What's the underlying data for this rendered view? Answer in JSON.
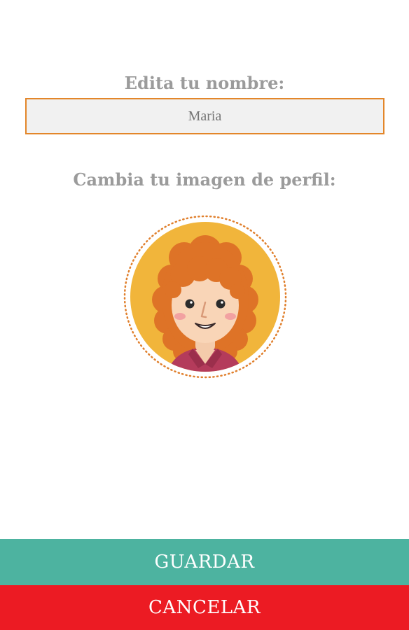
{
  "profile": {
    "name_label": "Edita tu nombre:",
    "name_placeholder": "Maria",
    "avatar_label": "Cambia tu imagen de perfil:",
    "avatar_icon": "female-avatar-icon"
  },
  "actions": {
    "save_label": "GUARDAR",
    "cancel_label": "CANCELAR"
  },
  "colors": {
    "input_border": "#e3862a",
    "avatar_background": "#f1b53b",
    "save_button": "#4db3a0",
    "cancel_button": "#ec1b23"
  }
}
